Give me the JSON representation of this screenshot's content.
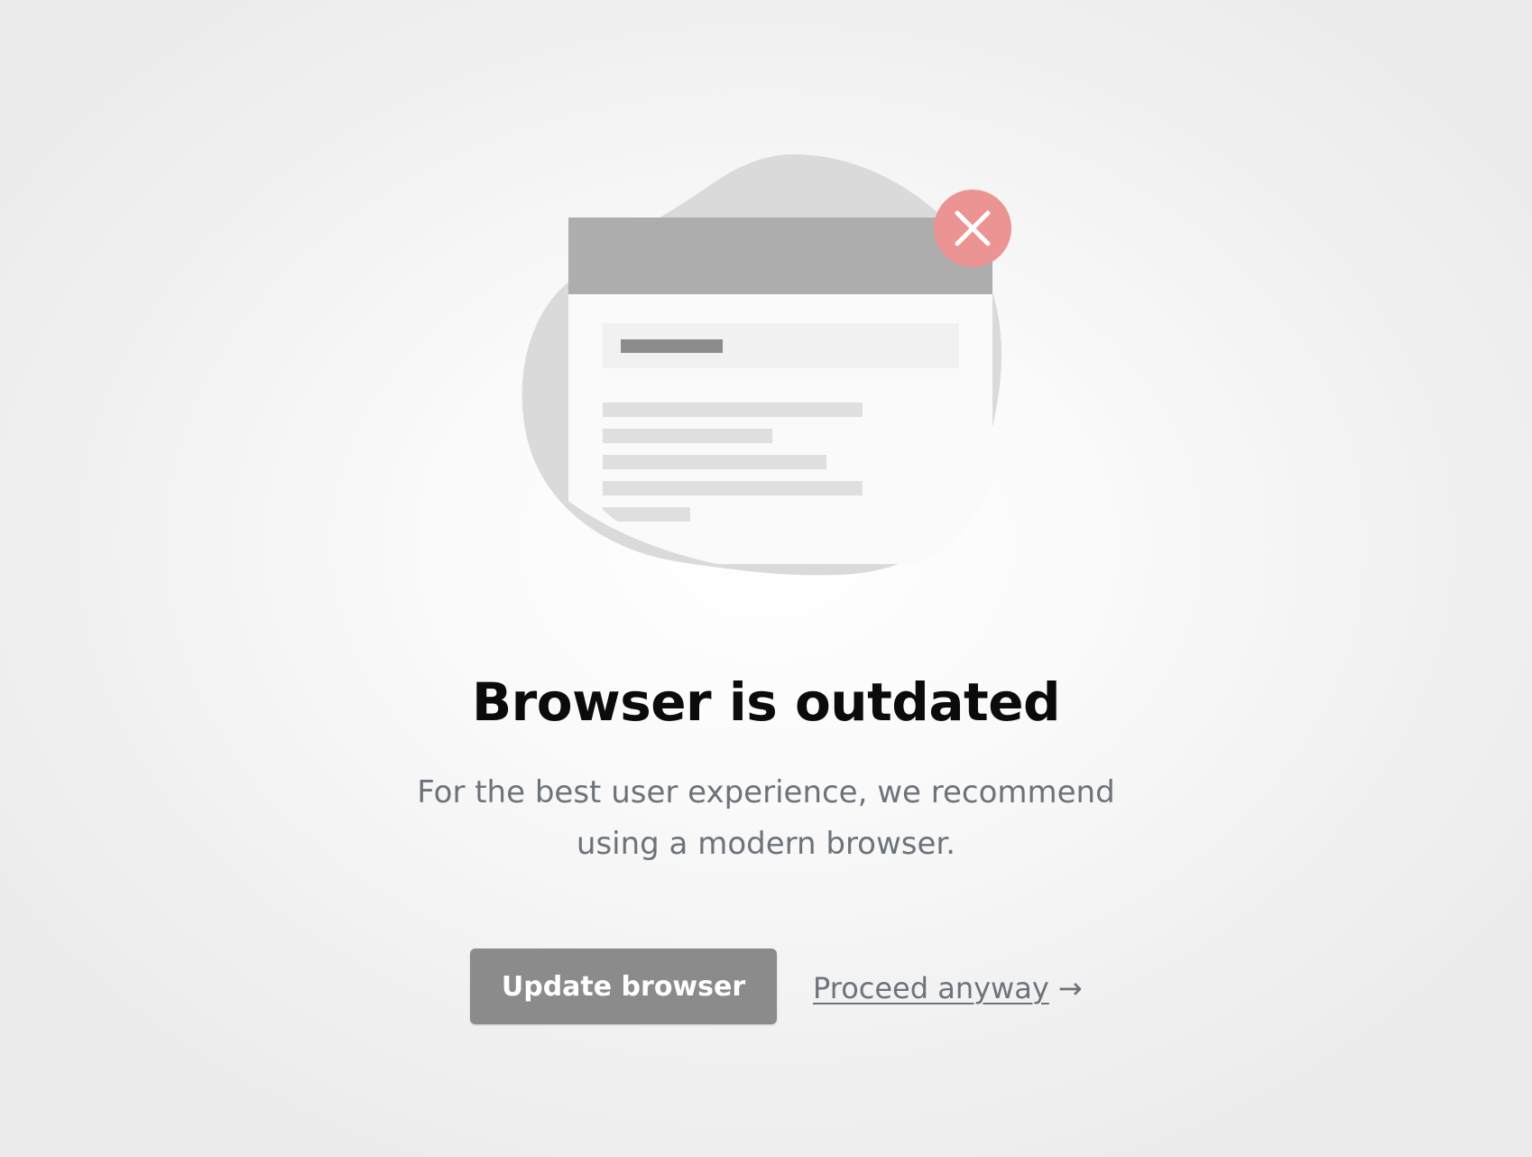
{
  "illustration": {
    "icon": "outdated-browser-illustration",
    "badge_icon": "close-icon",
    "colors": {
      "blob": "#dadada",
      "window_header": "#adadad",
      "window_body": "#fafafa",
      "address_bar": "#f1f1f1",
      "address_text": "#8c8c8c",
      "content_lines": "#dfdfdf",
      "badge": "#ec9393"
    }
  },
  "heading": {
    "title": "Browser is outdated",
    "subtitle": "For the best user experience, we recommend using a modern browser."
  },
  "actions": {
    "update_label": "Update browser",
    "proceed_label": "Proceed anyway",
    "proceed_arrow": "→"
  },
  "colors": {
    "button_bg": "#8b8b8b",
    "title": "#0b0b0b",
    "muted_text": "#6d737b"
  }
}
